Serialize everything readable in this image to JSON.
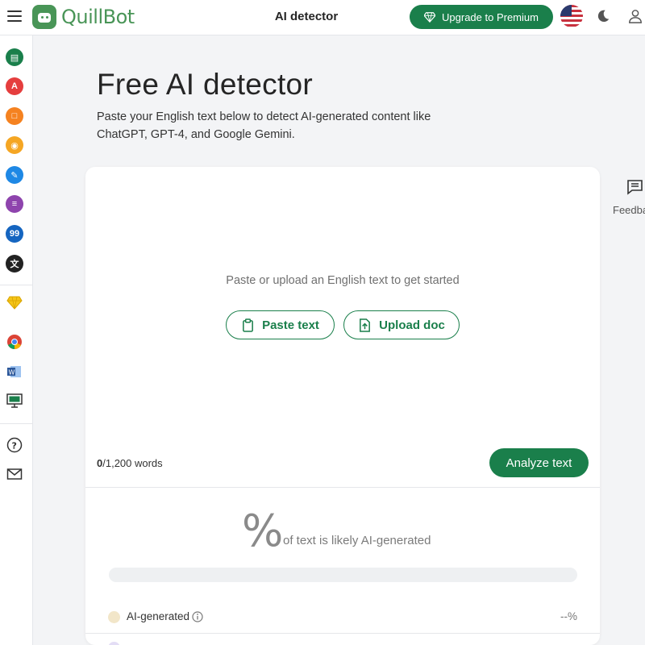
{
  "header": {
    "brand": "QuillBot",
    "title": "AI detector",
    "upgrade_label": "Upgrade to Premium",
    "accent": "#1a7f4b"
  },
  "sidebar": {
    "tools": [
      {
        "name": "paraphraser",
        "color": "#1a7f4b"
      },
      {
        "name": "grammar-checker",
        "color": "#e53e3e"
      },
      {
        "name": "ai-detector",
        "color": "#f58220"
      },
      {
        "name": "plagiarism-checker",
        "color": "#f5a623"
      },
      {
        "name": "ai-humanizer",
        "color": "#1e88e5"
      },
      {
        "name": "summarizer",
        "color": "#8e44ad"
      },
      {
        "name": "citation-generator",
        "color": "#1565c0"
      },
      {
        "name": "translator",
        "color": "#222222"
      }
    ],
    "bottom_icons": [
      "premium-diamond-icon",
      "chrome-extension-icon",
      "word-extension-icon",
      "desktop-app-icon",
      "help-icon",
      "mail-icon"
    ]
  },
  "main": {
    "heading": "Free AI detector",
    "subtitle": "Paste your English text below to detect AI-generated content like ChatGPT, GPT-4, and Google Gemini.",
    "prompt": "Paste or upload an English text to get started",
    "paste_label": "Paste text",
    "upload_label": "Upload doc",
    "word_count_current": "0",
    "word_count_limit": "/1,200 words",
    "analyze_label": "Analyze text",
    "result_symbol": "%",
    "result_caption": "of text is likely AI-generated",
    "ai_generated_fraction": 0,
    "legend": [
      {
        "label": "AI-generated",
        "value": "--%",
        "color": "#f2e6c9"
      }
    ]
  },
  "feedback": {
    "label": "Feedback"
  }
}
